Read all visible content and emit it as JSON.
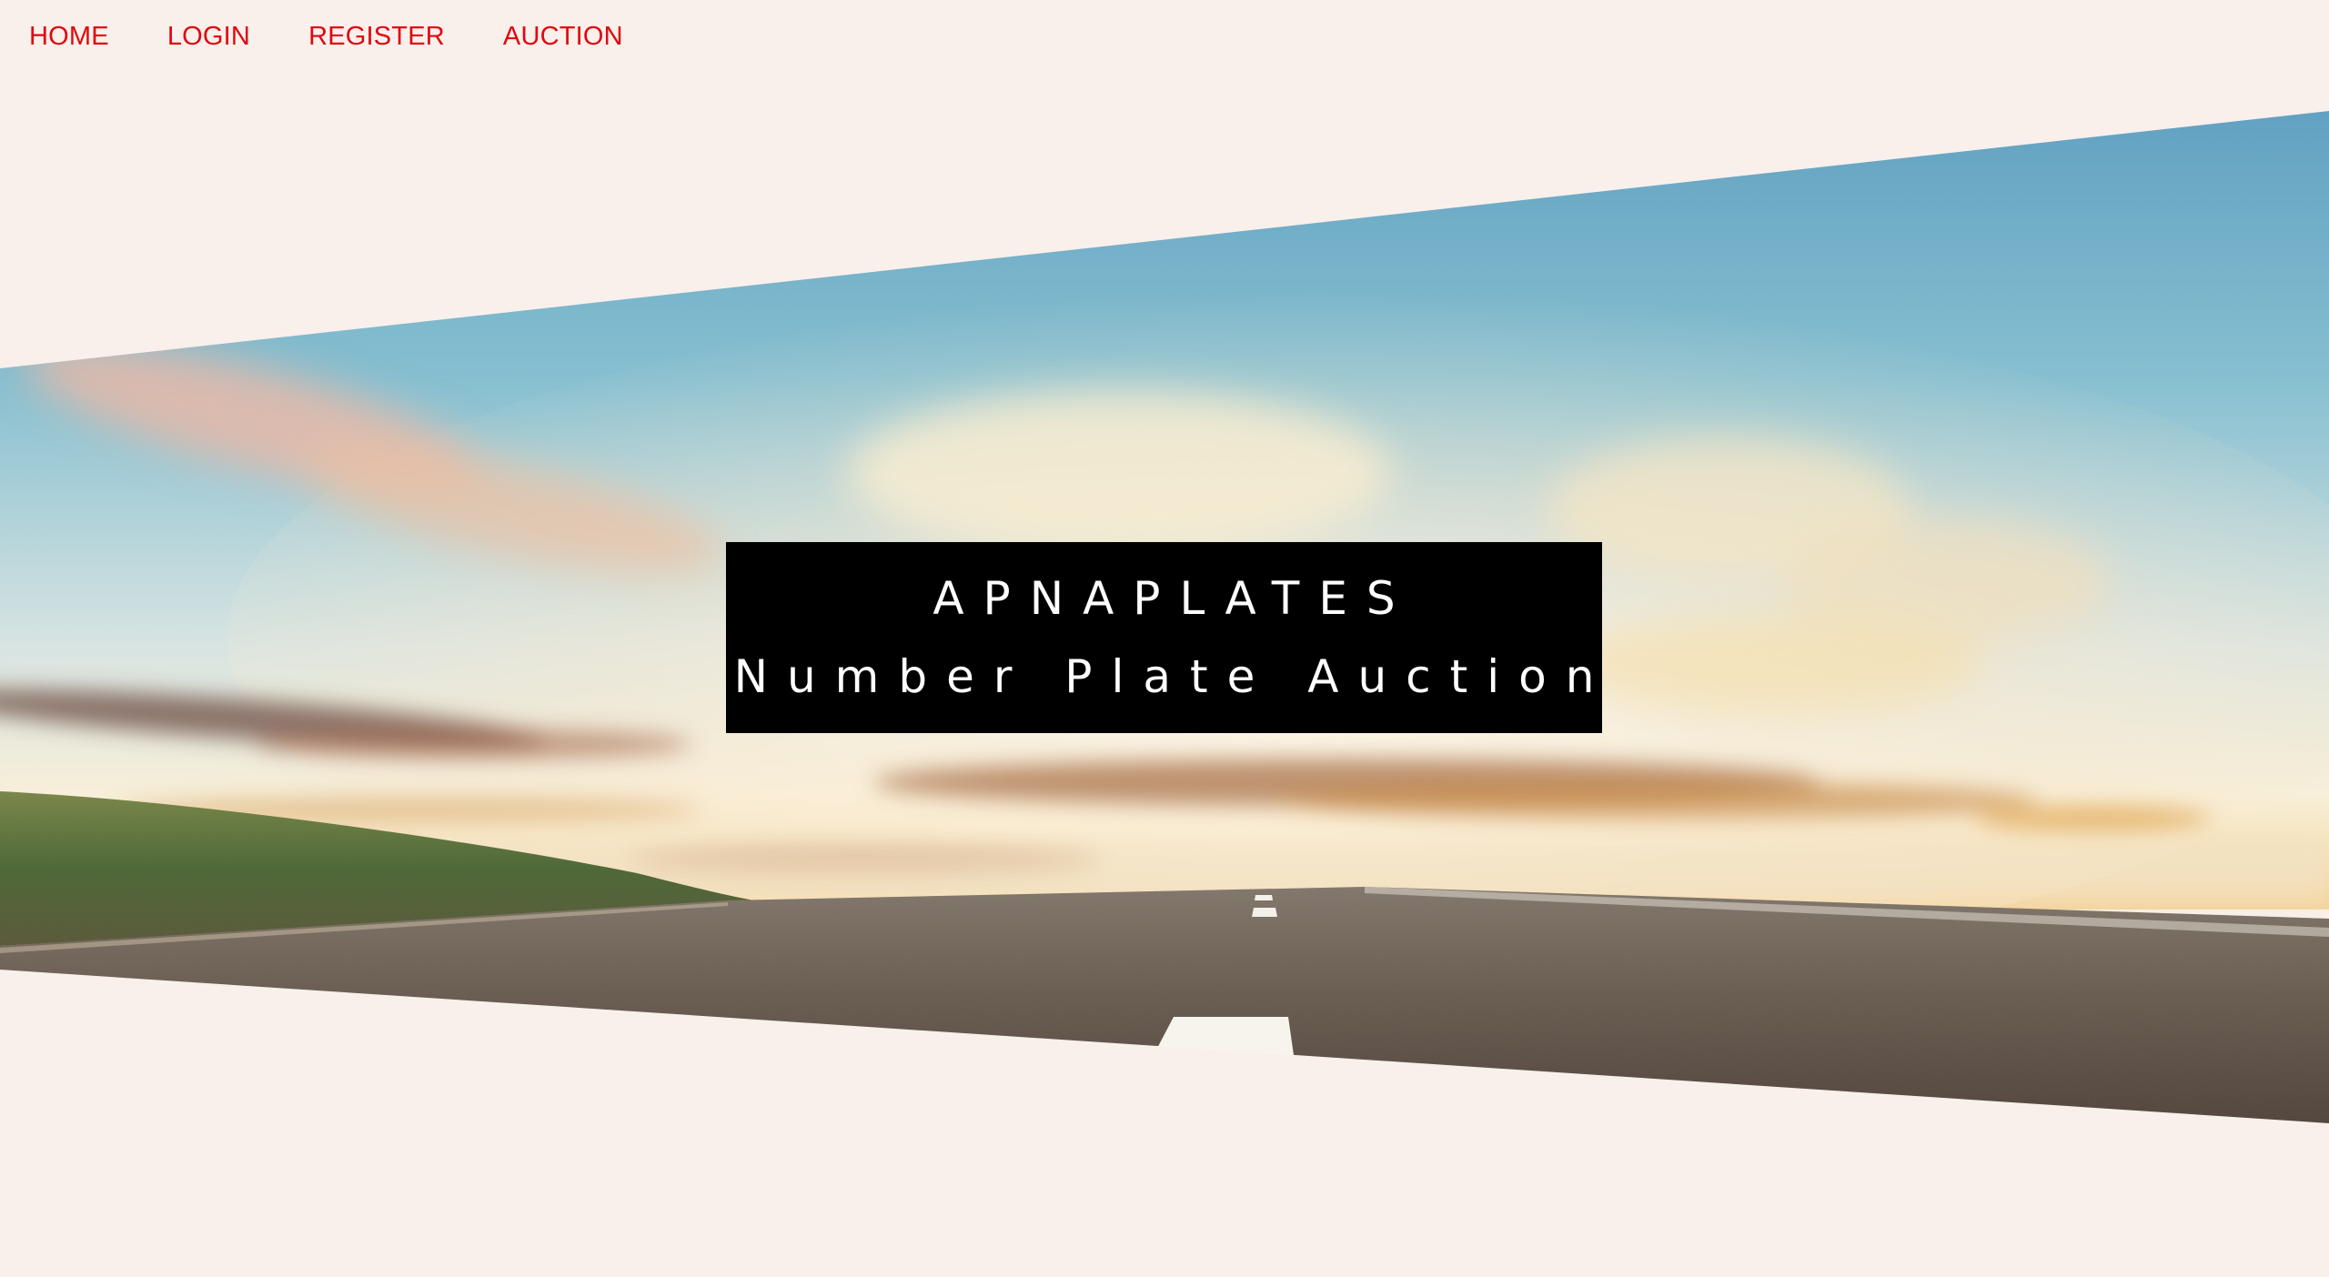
{
  "nav": {
    "items": [
      {
        "label": "HOME"
      },
      {
        "label": "LOGIN"
      },
      {
        "label": "REGISTER"
      },
      {
        "label": "AUCTION"
      }
    ],
    "link_color": "#e0070f"
  },
  "hero": {
    "title": "APNAPLATES",
    "subtitle": "Number Plate Auction",
    "box_color": "#000000",
    "text_color": "#ffffff"
  },
  "page": {
    "background_color": "#f9f0eb"
  }
}
